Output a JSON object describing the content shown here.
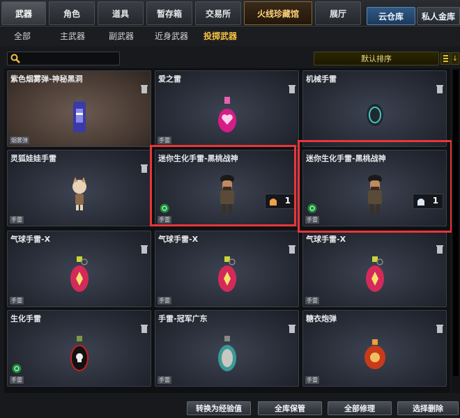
{
  "main_tabs": [
    "武器",
    "角色",
    "道具",
    "暂存箱",
    "交易所",
    "火线珍藏馆",
    "展厅"
  ],
  "right_tabs": [
    "云仓库",
    "私人金库"
  ],
  "sub_tabs": [
    "全部",
    "主武器",
    "副武器",
    "近身武器",
    "投掷武器"
  ],
  "search": {
    "placeholder": "",
    "value": ""
  },
  "sort": {
    "label": "默认排序"
  },
  "items": [
    {
      "name": "紫色烟雾弹-神秘黑洞",
      "tag": "烟雾弹",
      "icon": "purple-smoke-grenade-icon"
    },
    {
      "name": "爱之雷",
      "tag": "手雷",
      "icon": "pink-heart-grenade-icon"
    },
    {
      "name": "机械手雷",
      "tag": "",
      "icon": "mechanical-grenade-icon"
    },
    {
      "name": "灵狐娃娃手雷",
      "tag": "手雷",
      "icon": "fox-doll-grenade-icon"
    },
    {
      "name": "迷你生化手雷-黑桃战神",
      "tag": "手雷",
      "icon": "mini-soldier-grenade-icon",
      "count": "1",
      "count_icon": "orange-badge-icon"
    },
    {
      "name": "迷你生化手雷-黑桃战神",
      "tag": "手雷",
      "icon": "mini-soldier-grenade-icon",
      "count": "1",
      "count_icon": "white-badge-icon"
    },
    {
      "name": "气球手雷-X",
      "tag": "手雷",
      "icon": "balloon-grenade-icon"
    },
    {
      "name": "气球手雷-X",
      "tag": "手雷",
      "icon": "balloon-grenade-icon"
    },
    {
      "name": "气球手雷-X",
      "tag": "手雷",
      "icon": "balloon-grenade-icon"
    },
    {
      "name": "生化手雷",
      "tag": "手雷",
      "icon": "skull-grenade-icon"
    },
    {
      "name": "手雷-冠军广东",
      "tag": "手雷",
      "icon": "teal-grenade-icon"
    },
    {
      "name": "糖衣炮弹",
      "tag": "手雷",
      "icon": "candy-bomb-icon"
    }
  ],
  "bottom_buttons": [
    "转换为经验值",
    "全库保管",
    "全部修理",
    "选择删除"
  ],
  "colors": {
    "highlight": "#e8363a",
    "active_sub_tab": "#f5c342",
    "special_tab": "#ffd27a"
  }
}
